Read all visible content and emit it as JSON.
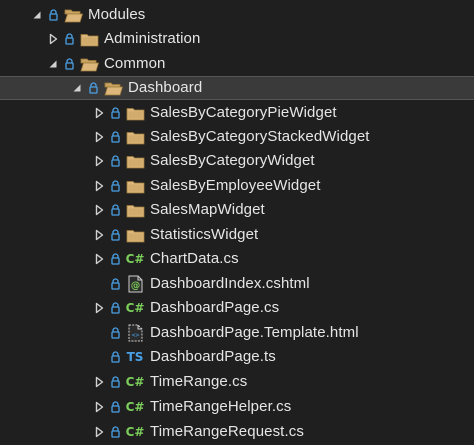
{
  "tree": {
    "nodes": [
      {
        "label": "Modules",
        "icon": "folder-open-icon",
        "expand": "expanded"
      },
      {
        "label": "Administration",
        "icon": "folder-icon",
        "expand": "collapsed"
      },
      {
        "label": "Common",
        "icon": "folder-open-icon",
        "expand": "expanded"
      },
      {
        "label": "Dashboard",
        "icon": "folder-open-icon",
        "expand": "expanded",
        "selected": true
      },
      {
        "label": "SalesByCategoryPieWidget",
        "icon": "folder-icon",
        "expand": "collapsed"
      },
      {
        "label": "SalesByCategoryStackedWidget",
        "icon": "folder-icon",
        "expand": "collapsed"
      },
      {
        "label": "SalesByCategoryWidget",
        "icon": "folder-icon",
        "expand": "collapsed"
      },
      {
        "label": "SalesByEmployeeWidget",
        "icon": "folder-icon",
        "expand": "collapsed"
      },
      {
        "label": "SalesMapWidget",
        "icon": "folder-icon",
        "expand": "collapsed"
      },
      {
        "label": "StatisticsWidget",
        "icon": "folder-icon",
        "expand": "collapsed"
      },
      {
        "label": "ChartData.cs",
        "icon": "csharp-file-icon",
        "icon_text": "C#",
        "expand": "collapsed"
      },
      {
        "label": "DashboardIndex.cshtml",
        "icon": "razor-file-icon",
        "icon_text": "@",
        "expand": "none"
      },
      {
        "label": "DashboardPage.cs",
        "icon": "csharp-file-icon",
        "icon_text": "C#",
        "expand": "collapsed"
      },
      {
        "label": "DashboardPage.Template.html",
        "icon": "html-file-icon",
        "icon_text": "<>",
        "expand": "none"
      },
      {
        "label": "DashboardPage.ts",
        "icon": "typescript-file-icon",
        "icon_text": "TS",
        "expand": "none"
      },
      {
        "label": "TimeRange.cs",
        "icon": "csharp-file-icon",
        "icon_text": "C#",
        "expand": "collapsed"
      },
      {
        "label": "TimeRangeHelper.cs",
        "icon": "csharp-file-icon",
        "icon_text": "C#",
        "expand": "collapsed"
      },
      {
        "label": "TimeRangeRequest.cs",
        "icon": "csharp-file-icon",
        "icon_text": "C#",
        "expand": "collapsed"
      }
    ]
  },
  "colors": {
    "background": "#1f1f1f",
    "selected_row": "#3a3a3a",
    "folder": "#dcb67a",
    "lock": "#4aa0e6",
    "csharp": "#7ccf5b",
    "typescript": "#4aa0e6"
  }
}
